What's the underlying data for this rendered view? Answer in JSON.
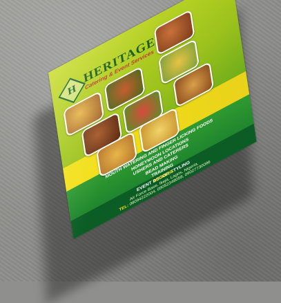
{
  "flyer": {
    "brand": "HERITAGE",
    "tagline": "Catering & Event Services",
    "services": [
      "MOUTH WATERING AND FINGER LICKING FOODS",
      "HONEYMOON LOCATIONS",
      "USHERS AND CATERERS",
      "BEAD MAKING",
      "TRAINING",
      "EVENT DECOR STYLING"
    ],
    "address_label": "ADDRESS",
    "address": "Air Force Base, Ikeja, Lagos, Nigeria.",
    "tel_label": "TEL:",
    "phones": "08094222004, 09052348058, 09027730096"
  },
  "food_colors": [
    "#b5622a",
    "#d9a52c",
    "#6a3a1c",
    "#8dbf3a",
    "#c44a2a",
    "#e0b640",
    "#a0522d",
    "#d97f35",
    "#c9a23a"
  ]
}
